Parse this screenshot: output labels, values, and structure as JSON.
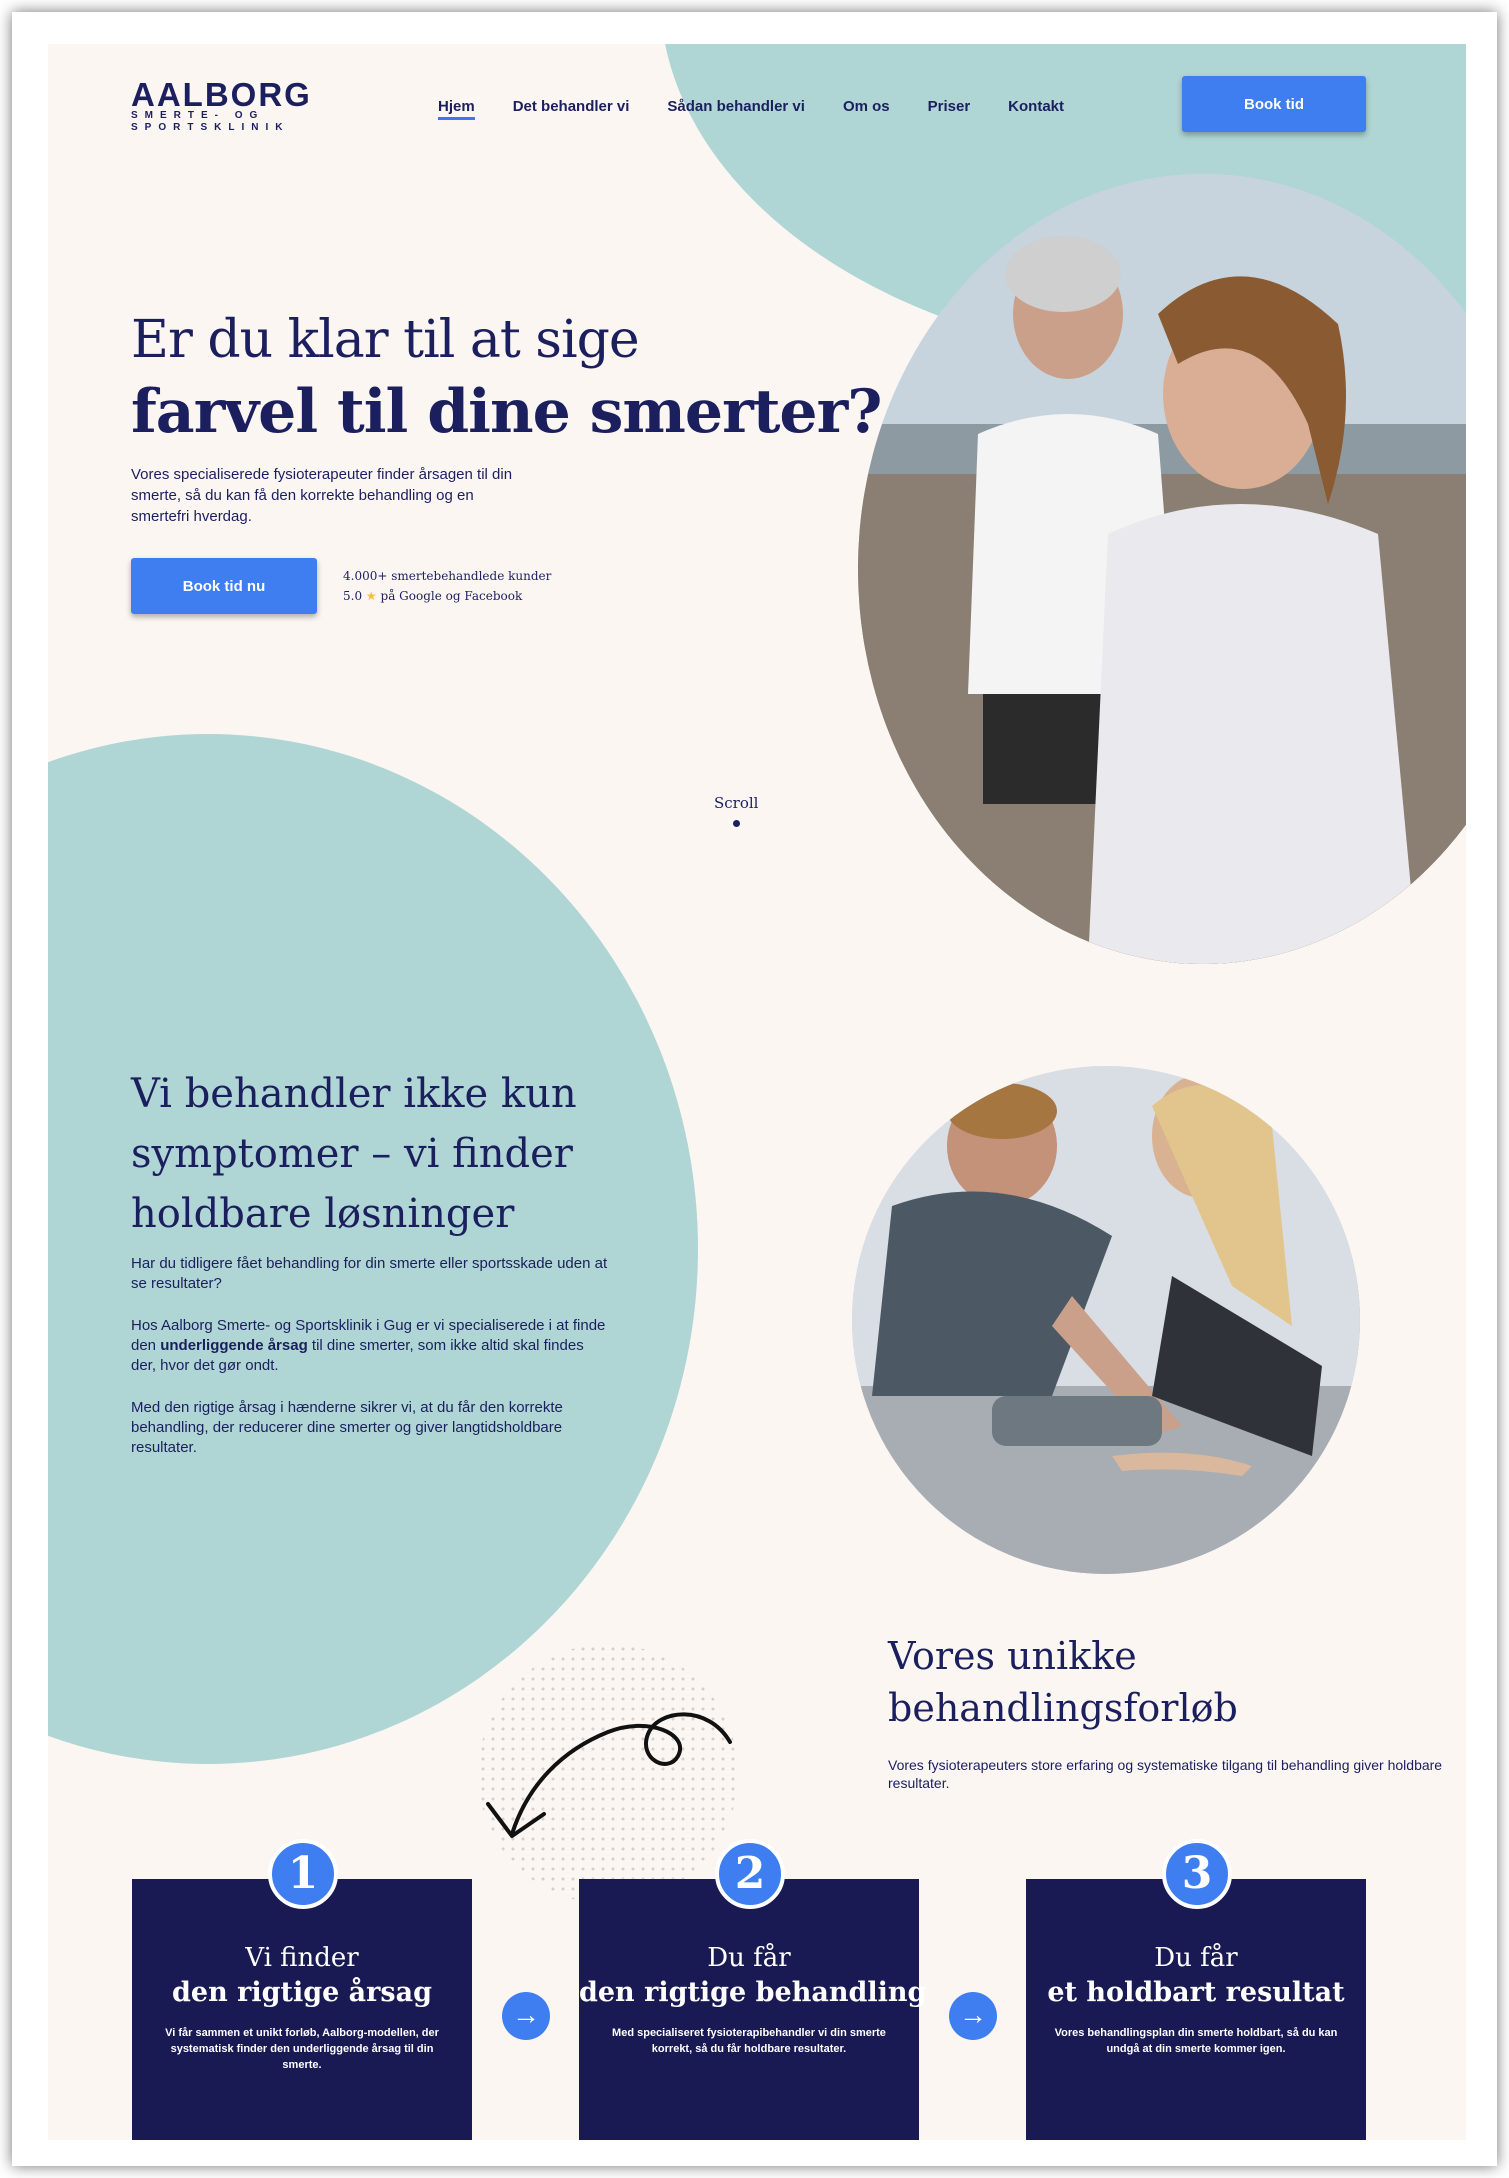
{
  "logo": {
    "line1": "AALBORG",
    "line2": "SMERTE- OG",
    "line3": "SPORTSKLINIK"
  },
  "nav": {
    "items": [
      "Hjem",
      "Det behandler vi",
      "Sådan behandler vi",
      "Om os",
      "Priser",
      "Kontakt"
    ],
    "cta": "Book tid"
  },
  "hero": {
    "title_line1": "Er du klar til at sige",
    "title_line2": "farvel til dine smerter?",
    "paragraph": "Vores specialiserede fysioterapeuter finder årsagen til din smerte, så du kan få den korrekte behandling og en smertefri hverdag.",
    "cta": "Book tid nu",
    "rating_line1": "4.000+ smertebehandlede kunder",
    "rating_score": "5.0",
    "rating_stars": "★",
    "rating_line2": "på Google og Facebook",
    "scroll_label": "Scroll"
  },
  "section2": {
    "title_line1": "Vi behandler ikke kun",
    "title_line2": "symptomer – vi finder",
    "title_line3": "holdbare løsninger",
    "p1": "Har du tidligere fået behandling for din smerte eller sportsskade uden at se resultater?",
    "p2_pre": "Hos Aalborg Smerte- og Sportsklinik i Gug er vi specialiserede i at finde den ",
    "p2_bold": "underliggende årsag",
    "p2_post": " til dine smerter, som ikke altid skal findes der, hvor det gør ondt.",
    "p3": "Med den rigtige årsag i hænderne sikrer vi, at du får den korrekte behandling, der reducerer dine smerter og giver langtidsholdbare resultater."
  },
  "section3": {
    "title_line1": "Vores unikke",
    "title_line2": "behandlingsforløb",
    "intro": "Vores fysioterapeuters store erfaring og systematiske tilgang til behandling giver holdbare resultater."
  },
  "steps": [
    {
      "num": "1",
      "t1": "Vi finder",
      "t2": "den rigtige årsag",
      "desc": "Vi får sammen et unikt forløb, Aalborg-modellen, der systematisk finder den underliggende årsag til din smerte."
    },
    {
      "num": "2",
      "t1": "Du får",
      "t2": "den rigtige behandling",
      "desc": "Med specialiseret fysioterapibehandler vi din smerte korrekt, så du får holdbare resultater."
    },
    {
      "num": "3",
      "t1": "Du får",
      "t2": "et holdbart resultat",
      "desc": "Vores behandlingsplan din smerte holdbart, så du kan undgå at din smerte kommer igen."
    }
  ]
}
